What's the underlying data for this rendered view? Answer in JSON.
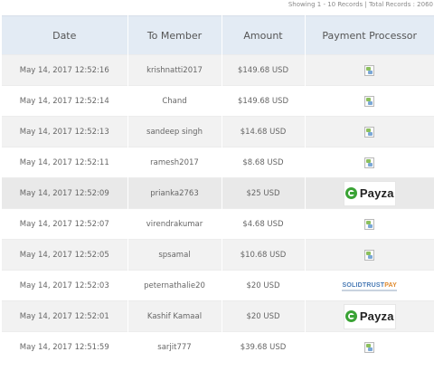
{
  "records_info": "Showing 1 - 10 Records | Total Records : 2060",
  "table": {
    "headers": [
      "Date",
      "To Member",
      "Amount",
      "Payment Processor"
    ],
    "rows": [
      {
        "date": "May 14, 2017 12:52:16",
        "member": "krishnatti2017",
        "amount": "$149.68 USD",
        "processor": "broken-image-icon"
      },
      {
        "date": "May 14, 2017 12:52:14",
        "member": "Chand",
        "amount": "$149.68 USD",
        "processor": "broken-image-icon"
      },
      {
        "date": "May 14, 2017 12:52:13",
        "member": "sandeep singh",
        "amount": "$14.68 USD",
        "processor": "broken-image-icon"
      },
      {
        "date": "May 14, 2017 12:52:11",
        "member": "ramesh2017",
        "amount": "$8.68 USD",
        "processor": "broken-image-icon"
      },
      {
        "date": "May 14, 2017 12:52:09",
        "member": "prianka2763",
        "amount": "$25 USD",
        "processor": "Payza"
      },
      {
        "date": "May 14, 2017 12:52:07",
        "member": "virendrakumar",
        "amount": "$4.68 USD",
        "processor": "broken-image-icon"
      },
      {
        "date": "May 14, 2017 12:52:05",
        "member": "spsamal",
        "amount": "$10.68 USD",
        "processor": "broken-image-icon"
      },
      {
        "date": "May 14, 2017 12:52:03",
        "member": "peternathalie20",
        "amount": "$20 USD",
        "processor": "SolidTrustPay"
      },
      {
        "date": "May 14, 2017 12:52:01",
        "member": "Kashif Kamaal",
        "amount": "$20 USD",
        "processor": "Payza"
      },
      {
        "date": "May 14, 2017 12:51:59",
        "member": "sarjit777",
        "amount": "$39.68 USD",
        "processor": "broken-image-icon"
      }
    ]
  },
  "logos": {
    "payza_word": "Payza",
    "stp_solid": "SOLIDTRUST",
    "stp_pay": "PAY"
  },
  "colors": {
    "header_bg": "#e3ebf4",
    "row_alt_bg": "#f2f2f2",
    "payza_green": "#3aa335",
    "stp_blue": "#4a7bb5",
    "stp_orange": "#e08a2e"
  }
}
